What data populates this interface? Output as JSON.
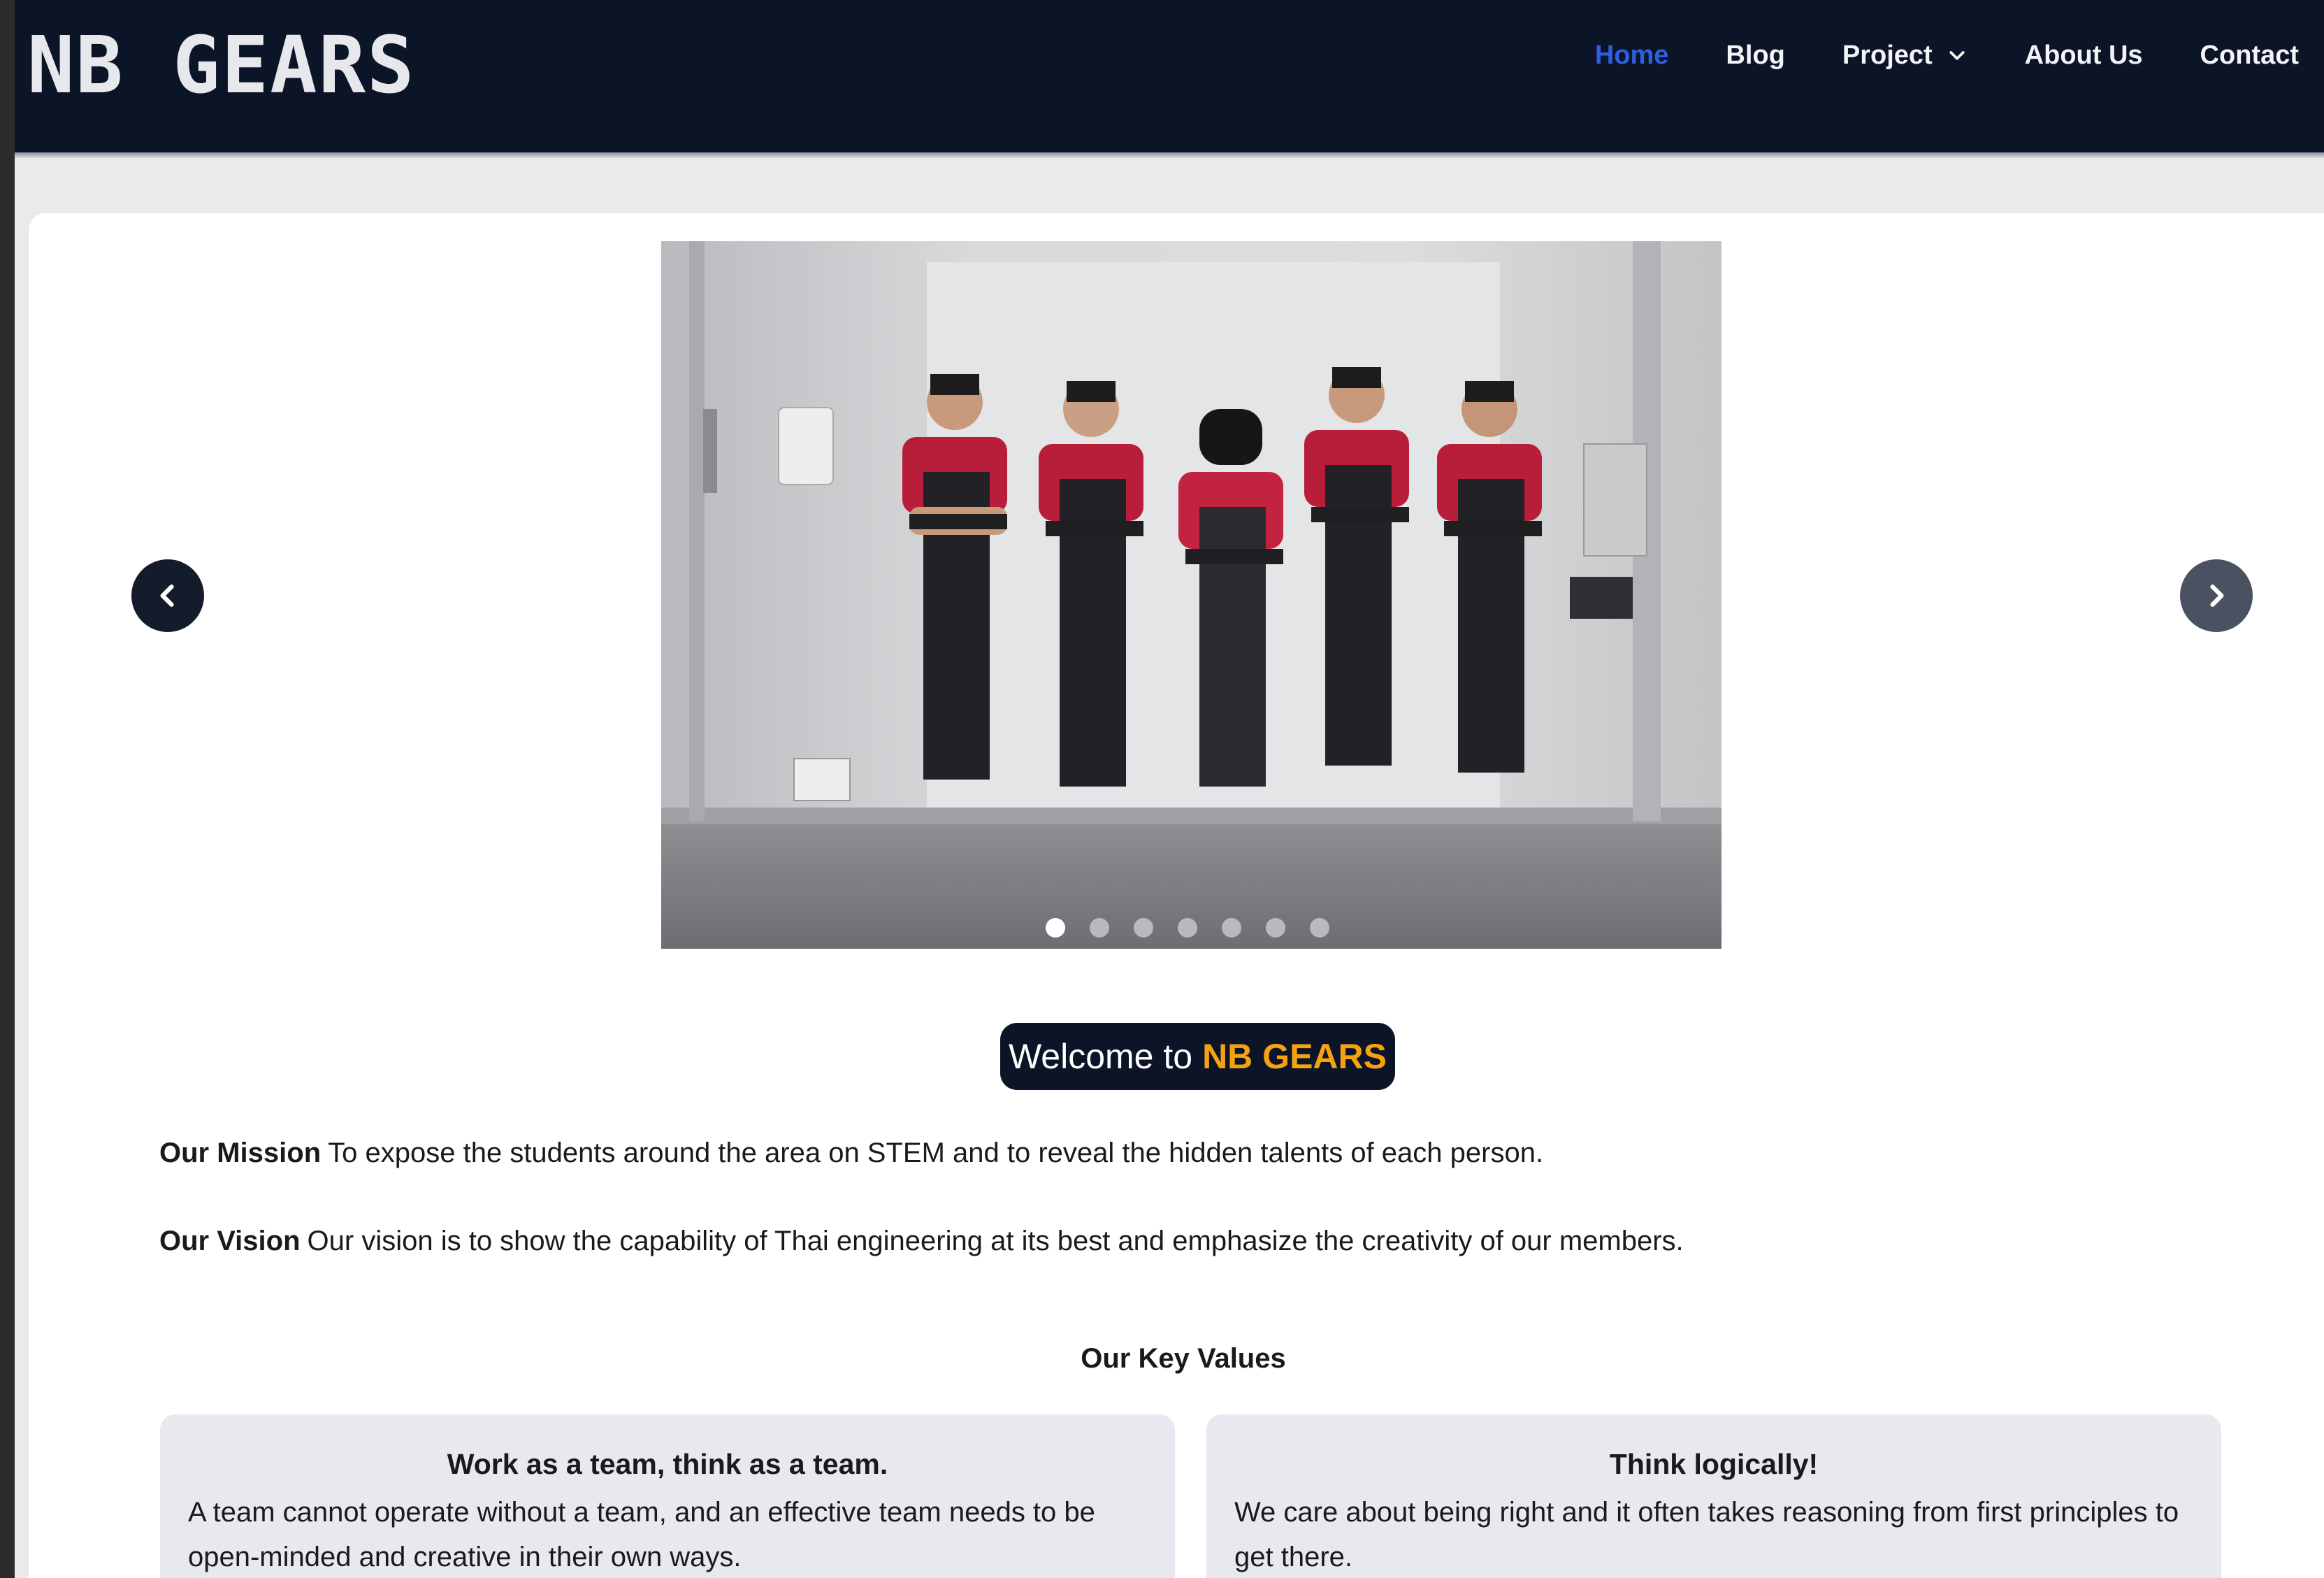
{
  "brand": {
    "logo_text": "NB GEARS"
  },
  "nav": {
    "items": [
      {
        "label": "Home",
        "active": true
      },
      {
        "label": "Blog",
        "active": false
      },
      {
        "label": "Project",
        "active": false,
        "has_dropdown": true
      },
      {
        "label": "About Us",
        "active": false
      },
      {
        "label": "Contact",
        "active": false
      }
    ]
  },
  "carousel": {
    "slide_count": 7,
    "active_index": 0,
    "prev_icon": "chevron-left-icon",
    "next_icon": "chevron-right-icon"
  },
  "welcome": {
    "prefix": "Welcome to",
    "brand": "NB GEARS"
  },
  "mission": {
    "label": "Our Mission",
    "text": "To expose the students around the area on STEM and to reveal the hidden talents of each person."
  },
  "vision": {
    "label": "Our Vision",
    "text": "Our vision is to show the capability of Thai engineering at its best and emphasize the creativity of our members."
  },
  "key_values": {
    "title": "Our Key Values",
    "items": [
      {
        "title": "Work as a team, think as a team.",
        "body": "A team cannot operate without a team, and an effective team needs to be open-minded and creative in their own ways."
      },
      {
        "title": "Think logically!",
        "body": "We care about being right and it often takes reasoning from first principles to get there."
      }
    ]
  },
  "colors": {
    "navbar_bg": "#0c1427",
    "nav_active": "#2f5fe0",
    "brand_accent": "#f5a212",
    "card_bg": "#e8e9ee"
  }
}
